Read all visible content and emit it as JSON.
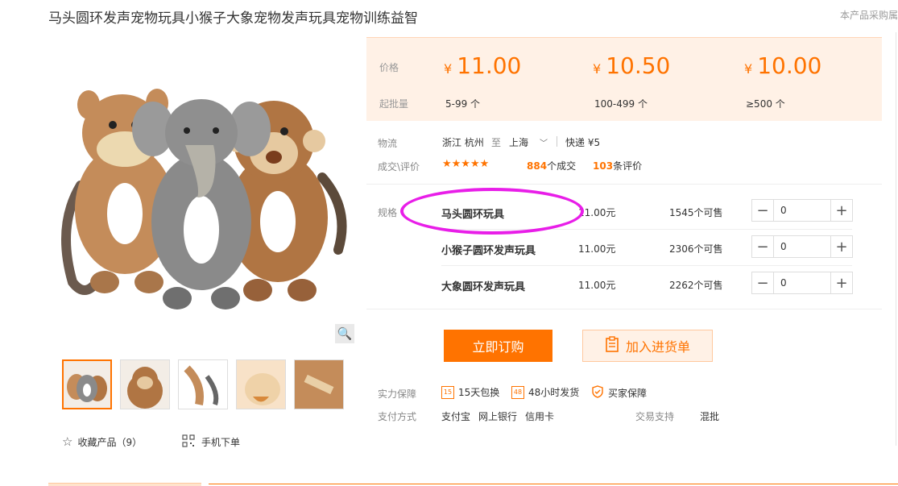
{
  "product": {
    "title": "马头圆环发声宠物玩具小猴子大象宠物发声玩具宠物训练益智",
    "top_right_note": "本产品采购属"
  },
  "gallery": {
    "zoom_icon": "magnifier-icon",
    "thumb_count": 5
  },
  "actions_bottom": {
    "favorite": "收藏产品（9）",
    "mobile_order": "手机下单"
  },
  "price": {
    "price_label": "价格",
    "moq_label": "起批量",
    "currency": "¥",
    "tiers": [
      {
        "price": "11.00",
        "range": "5-99 个"
      },
      {
        "price": "10.50",
        "range": "100-499 个"
      },
      {
        "price": "10.00",
        "range": "≥500 个"
      }
    ]
  },
  "logistics": {
    "label": "物流",
    "from": "浙江 杭州",
    "to_word": "至",
    "to_city": "上海",
    "shipping": "快递 ¥5"
  },
  "deals": {
    "label": "成交\\评价",
    "stars": "★★★★★",
    "deals_count": "884",
    "deals_suffix": "个成交",
    "review_count": "103",
    "review_suffix": "条评价"
  },
  "specs": {
    "label": "规格",
    "items": [
      {
        "name": "马头圆环玩具",
        "price": "11.00元",
        "stock": "1545个可售",
        "qty": "0"
      },
      {
        "name": "小猴子圆环发声玩具",
        "price": "11.00元",
        "stock": "2306个可售",
        "qty": "0"
      },
      {
        "name": "大象圆环发声玩具",
        "price": "11.00元",
        "stock": "2262个可售",
        "qty": "0"
      }
    ]
  },
  "buttons": {
    "buy_now": "立即订购",
    "add_cart": "加入进货单"
  },
  "guarantee": {
    "label": "实力保障",
    "items": [
      "15天包换",
      "48小时发货",
      "买家保障"
    ],
    "icon_texts": [
      "15",
      "48"
    ]
  },
  "payment": {
    "label": "支付方式",
    "methods": [
      "支付宝",
      "网上银行",
      "信用卡"
    ],
    "trade_label": "交易支持",
    "trade_value": "混批"
  },
  "colors": {
    "accent": "#ff7300",
    "highlight": "#e81ee8"
  }
}
